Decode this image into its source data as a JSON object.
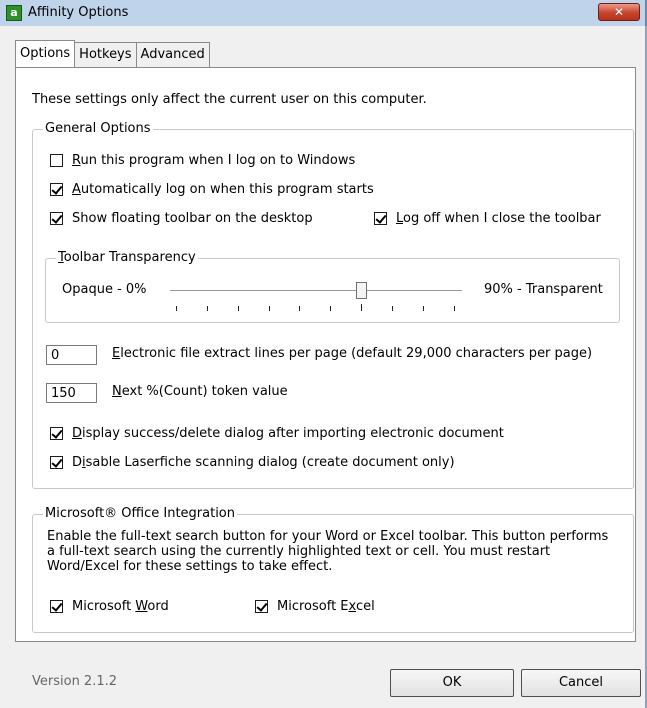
{
  "window": {
    "title": "Affinity Options",
    "app_icon": "a",
    "close_icon": "close-icon",
    "close_glyph": "✕"
  },
  "tabs": [
    {
      "label": "Options",
      "active": true
    },
    {
      "label": "Hotkeys",
      "active": false
    },
    {
      "label": "Advanced",
      "active": false
    }
  ],
  "intro": "These settings only affect the current user on this computer.",
  "general": {
    "title": "General Options",
    "run_on_logon": {
      "pre": "",
      "key": "R",
      "post": "un this program when I log on to Windows",
      "checked": false
    },
    "auto_logon": {
      "pre": "",
      "key": "A",
      "post": "utomatically log on when this program starts",
      "checked": true
    },
    "floating_toolbar": {
      "pre": "Show floating toolbar on the desktop",
      "key": "",
      "post": "",
      "checked": true
    },
    "logoff_close": {
      "pre": "",
      "key": "L",
      "post": "og off when I close the toolbar",
      "checked": true
    },
    "transparency": {
      "title_key": "T",
      "title_rest": "oolbar Transparency",
      "min_label": "Opaque - 0%",
      "max_label": "90% - Transparent",
      "value": 0.65
    },
    "extract_lines": {
      "value": "0",
      "key": "E",
      "post": "lectronic file extract lines per page (default 29,000 characters per page)"
    },
    "token_value": {
      "value": "150",
      "key": "N",
      "post": "ext %(Count) token value"
    },
    "display_success": {
      "pre": "",
      "key": "D",
      "post": "isplay success/delete dialog after importing electronic document",
      "checked": true
    },
    "disable_scanning": {
      "pre": "D",
      "key": "i",
      "post": "sable Laserfiche scanning dialog (create document only)",
      "checked": true
    }
  },
  "office": {
    "title": "Microsoft® Office Integration",
    "description": "Enable the full-text search button for your Word or Excel toolbar. This button performs a full-text search using the currently highlighted text or cell. You must restart Word/Excel for these settings to take effect.",
    "word": {
      "pre": "Microsoft ",
      "key": "W",
      "post": "ord",
      "checked": true
    },
    "excel": {
      "pre": "Microsoft E",
      "key": "x",
      "post": "cel",
      "checked": true
    }
  },
  "footer": {
    "version": "Version 2.1.2",
    "ok_label": "OK",
    "cancel_label": "Cancel"
  }
}
